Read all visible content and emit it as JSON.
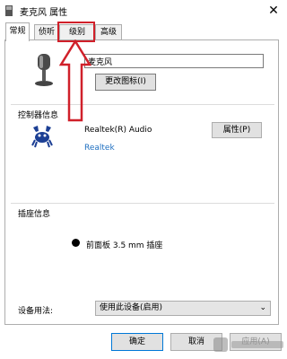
{
  "window": {
    "title": "麦克风 属性",
    "close_glyph": "✕"
  },
  "tabs": [
    {
      "label": "常规",
      "active": true
    },
    {
      "label": "侦听",
      "active": false
    },
    {
      "label": "级别",
      "active": false
    },
    {
      "label": "高级",
      "active": false
    }
  ],
  "general": {
    "device_name_value": "麦克风",
    "change_icon_label": "更改图标(I)"
  },
  "controller": {
    "section_title": "控制器信息",
    "device": "Realtek(R) Audio",
    "vendor": "Realtek",
    "properties_label": "属性(P)"
  },
  "jack": {
    "section_title": "插座信息",
    "text": "前面板 3.5 mm 插座"
  },
  "usage": {
    "label": "设备用法:",
    "selected": "使用此设备(启用)",
    "chevron": "⌄"
  },
  "footer": {
    "ok": "确定",
    "cancel": "取消",
    "apply": "应用(A)"
  },
  "colors": {
    "annotation_red": "#d0202a",
    "link_blue": "#1e6fc0",
    "realtek_blue": "#1c3f94"
  },
  "icons": {
    "window": "speaker-icon",
    "device": "microphone-icon",
    "controller": "realtek-crab-icon"
  }
}
